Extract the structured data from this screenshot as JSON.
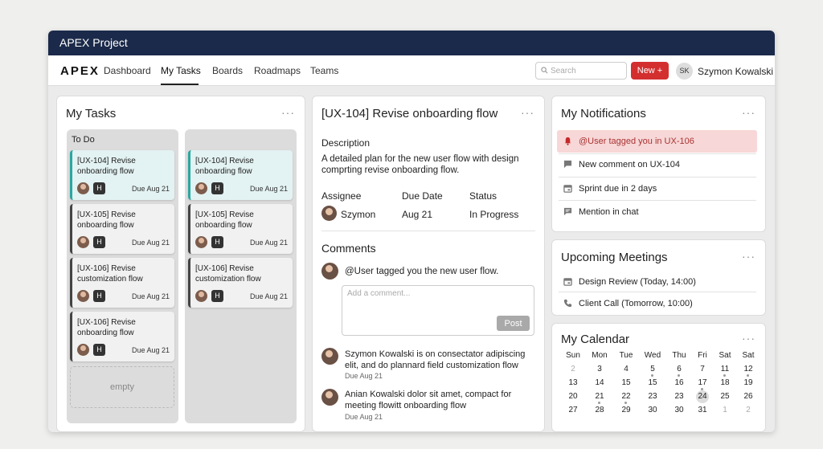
{
  "window": {
    "title": "APEX Project"
  },
  "nav": {
    "logo": "APEX",
    "tabs": [
      "Dashboard",
      "My Tasks",
      "Boards",
      "Roadmaps",
      "Teams"
    ],
    "search_placeholder": "Search",
    "new_label": "New +",
    "user_initials": "SK",
    "user_name": "Szymon Kowalski"
  },
  "my_tasks": {
    "title": "My Tasks",
    "more": "···",
    "columns": [
      {
        "title": "To Do",
        "cards": [
          {
            "title": "[UX-104] Revise onboarding flow",
            "tag": "H",
            "due": "Due Aug 21"
          },
          {
            "title": "[UX-105] Revise onboarding flow",
            "tag": "H",
            "due": "Due Aug 21"
          },
          {
            "title": "[UX-106] Revise customization flow",
            "tag": "H",
            "due": "Due Aug 21"
          },
          {
            "title": "[UX-106] Revise onboarding flow",
            "tag": "H",
            "due": "Due Aug 21"
          }
        ],
        "empty_label": "empty"
      },
      {
        "title": "",
        "cards": [
          {
            "title": "[UX-104] Revise onboarding flow",
            "tag": "H",
            "due": "Due Aug 21"
          },
          {
            "title": "[UX-105] Revise onboarding flow",
            "tag": "H",
            "due": "Due Aug 21"
          },
          {
            "title": "[UX-106] Revise customization flow",
            "tag": "H",
            "due": "Due Aug 21"
          }
        ]
      }
    ]
  },
  "detail": {
    "title": "[UX-104] Revise onboarding flow",
    "more": "···",
    "description_label": "Description",
    "description": "A detailed plan for the new user flow with design comprting revise onboarding flow.",
    "assignee_label": "Assignee",
    "assignee": "Szymon",
    "due_label": "Due Date",
    "due": "Aug 21",
    "status_label": "Status",
    "status": "In Progress",
    "comments_label": "Comments",
    "top_comment": "@User tagged you the new user flow.",
    "comment_placeholder": "Add a comment...",
    "post_label": "Post",
    "comments": [
      {
        "text": "Szymon Kowalski is on consectator adipiscing elit, and do plannard field customization flow",
        "date": "Due Aug 21"
      },
      {
        "text": "Anian Kowalski dolor sit amet, compact for meeting flowitt onboarding flow",
        "date": "Due Aug 21"
      }
    ]
  },
  "notifications": {
    "title": "My Notifications",
    "more": "···",
    "items": [
      {
        "icon": "bell-icon",
        "text": "@User tagged you in UX-106"
      },
      {
        "icon": "comment-icon",
        "text": "New comment on UX-104"
      },
      {
        "icon": "calendar-icon",
        "text": "Sprint due in 2 days"
      },
      {
        "icon": "chat-icon",
        "text": "Mention in chat"
      }
    ]
  },
  "meetings": {
    "title": "Upcoming Meetings",
    "more": "···",
    "items": [
      {
        "icon": "calendar-icon",
        "text": "Design Review (Today, 14:00)"
      },
      {
        "icon": "phone-icon",
        "text": "Client Call (Tomorrow, 10:00)"
      }
    ]
  },
  "calendar": {
    "title": "My Calendar",
    "more": "···",
    "weekdays": [
      "Sun",
      "Mon",
      "Tue",
      "Wed",
      "Thu",
      "Fri",
      "Sat",
      "Sat"
    ],
    "weeks": [
      [
        "2",
        "3",
        "4",
        "5",
        "6",
        "7",
        "11",
        "12"
      ],
      [
        "13",
        "14",
        "15",
        "15",
        "16",
        "17",
        "18",
        "19"
      ],
      [
        "20",
        "21",
        "22",
        "23",
        "23",
        "24",
        "25",
        "26"
      ],
      [
        "27",
        "28",
        "29",
        "30",
        "30",
        "31",
        "1",
        "2"
      ]
    ],
    "today": "24"
  },
  "colors": {
    "titlebar": "#1b2a4a",
    "accent": "#d32f2f",
    "highlight_card": "#e3f2f2",
    "notification_highlight": "#f7d7d7"
  }
}
